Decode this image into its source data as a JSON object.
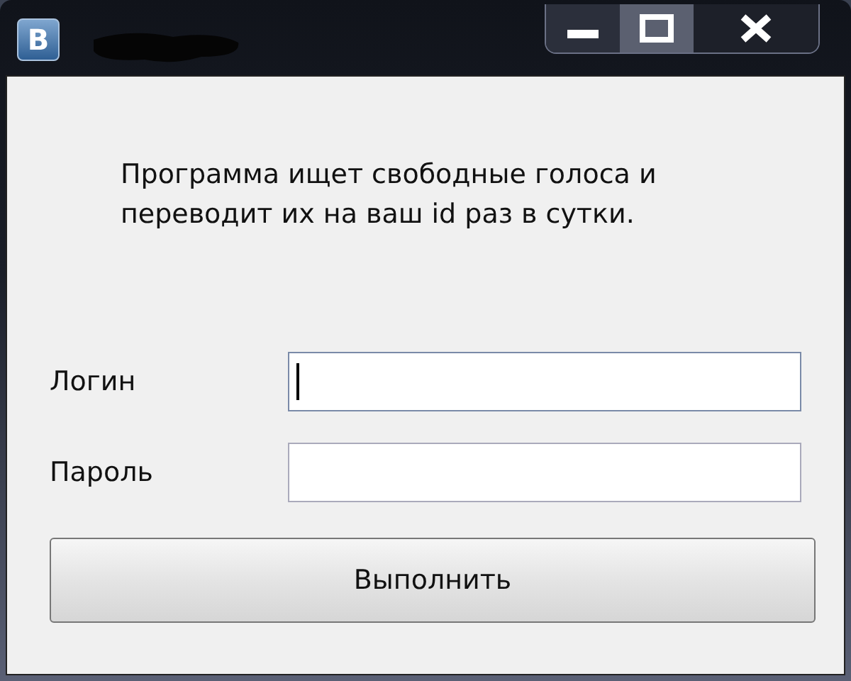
{
  "window": {
    "app_icon": "В",
    "title_redacted": true,
    "controls": [
      {
        "kind": "minimize",
        "selected": false
      },
      {
        "kind": "maximize",
        "selected": true
      },
      {
        "kind": "close",
        "selected": false
      }
    ]
  },
  "description": "Программа ищет свободные голоса и переводит их на ваш id раз в сутки.",
  "fields": [
    {
      "label": "Логин",
      "focused": true
    },
    {
      "label": "Пароль",
      "focused": false
    }
  ],
  "button": "Выполнить"
}
